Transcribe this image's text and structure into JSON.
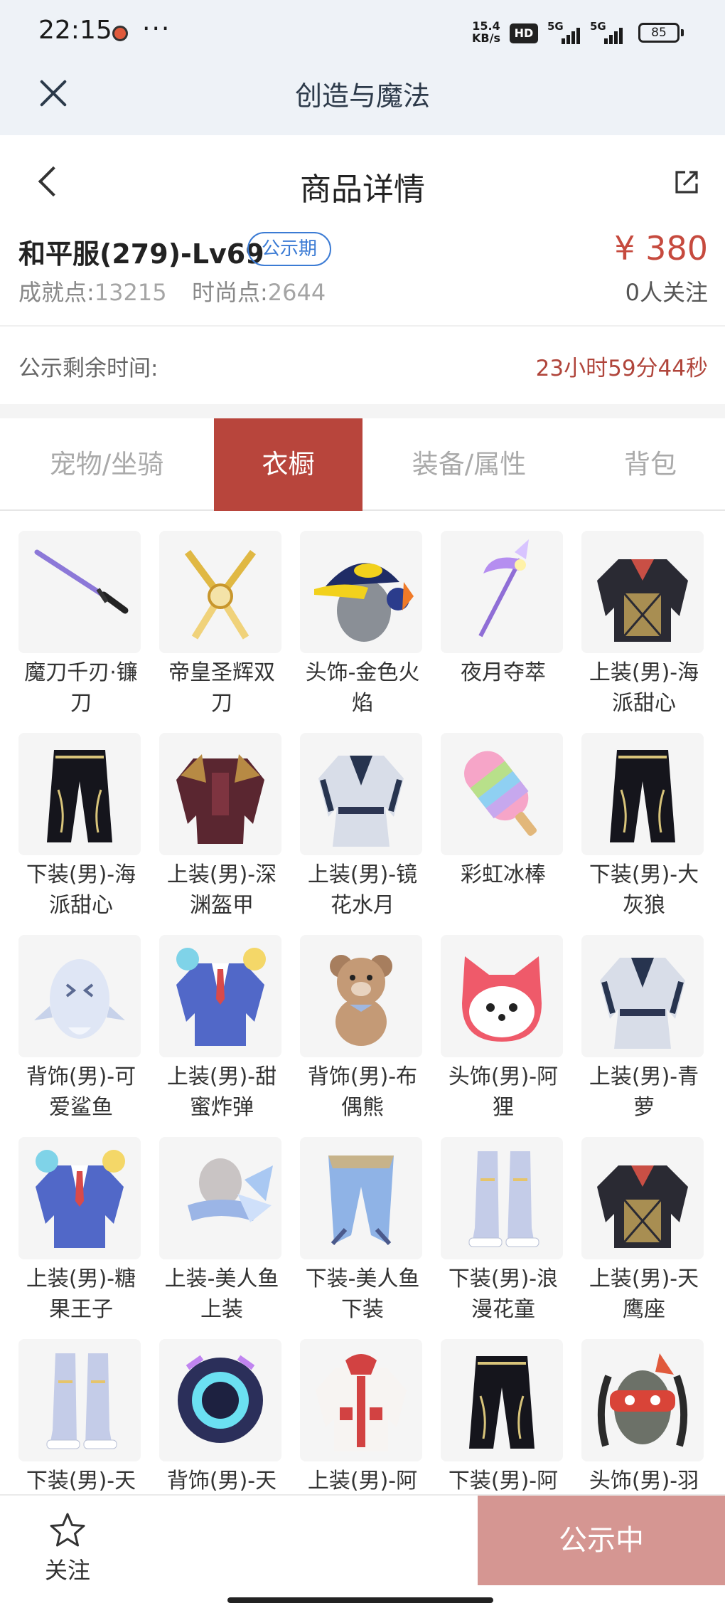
{
  "status_bar": {
    "time": "22:15",
    "more": "···",
    "speed_value": "15.4",
    "speed_unit": "KB/s",
    "hd": "HD",
    "net_type": "5G",
    "battery": "85"
  },
  "app_bar": {
    "title": "创造与魔法"
  },
  "header": {
    "title": "商品详情"
  },
  "product": {
    "name": "和平服(279)-Lv69",
    "tag": "公示期",
    "price": "¥ 380",
    "achievement_label": "成就点:",
    "achievement_value": "13215",
    "fashion_label": "时尚点:",
    "fashion_value": "2644",
    "followers": "0人关注"
  },
  "countdown": {
    "label": "公示剩余时间:",
    "value": "23小时59分44秒"
  },
  "tabs": [
    {
      "label": "宠物/坐骑",
      "active": false
    },
    {
      "label": "衣橱",
      "active": true
    },
    {
      "label": "装备/属性",
      "active": false
    },
    {
      "label": "背包",
      "active": false
    }
  ],
  "items": [
    {
      "name": "魔刀千刃·镰刀",
      "icon": "sword-icon"
    },
    {
      "name": "帝皇圣辉双刀",
      "icon": "dual-blades-icon"
    },
    {
      "name": "头饰-金色火焰",
      "icon": "cap-icon"
    },
    {
      "name": "夜月夺萃",
      "icon": "scythe-icon"
    },
    {
      "name": "上装(男)-海派甜心",
      "icon": "jacket-icon"
    },
    {
      "name": "下装(男)-海派甜心",
      "icon": "pants-icon"
    },
    {
      "name": "上装(男)-深渊盔甲",
      "icon": "armor-icon"
    },
    {
      "name": "上装(男)-镜花水月",
      "icon": "robe-icon"
    },
    {
      "name": "彩虹冰棒",
      "icon": "popsicle-icon"
    },
    {
      "name": "下装(男)-大灰狼",
      "icon": "pants-icon"
    },
    {
      "name": "背饰(男)-可爱鲨鱼",
      "icon": "shark-icon"
    },
    {
      "name": "上装(男)-甜蜜炸弹",
      "icon": "suit-icon"
    },
    {
      "name": "背饰(男)-布偶熊",
      "icon": "teddy-bear-icon"
    },
    {
      "name": "头饰(男)-阿狸",
      "icon": "fox-head-icon"
    },
    {
      "name": "上装(男)-青萝",
      "icon": "robe-icon"
    },
    {
      "name": "上装(男)-糖果王子",
      "icon": "suit-icon"
    },
    {
      "name": "上装-美人鱼上装",
      "icon": "mermaid-top-icon"
    },
    {
      "name": "下装-美人鱼下装",
      "icon": "mermaid-tail-icon"
    },
    {
      "name": "下装(男)-浪漫花童",
      "icon": "boots-icon"
    },
    {
      "name": "上装(男)-天鹰座",
      "icon": "jacket-icon"
    },
    {
      "name": "下装(男)-天",
      "icon": "boots-icon"
    },
    {
      "name": "背饰(男)-天",
      "icon": "helmet-icon"
    },
    {
      "name": "上装(男)-阿",
      "icon": "hoodie-icon"
    },
    {
      "name": "下装(男)-阿",
      "icon": "pants-icon"
    },
    {
      "name": "头饰(男)-羽",
      "icon": "mask-icon"
    }
  ],
  "bottom": {
    "follow": "关注",
    "action": "公示中"
  },
  "colors": {
    "accent": "#b8453c",
    "price": "#c64a3e",
    "link": "#3b7bd4",
    "disabled_action": "#d59692"
  }
}
